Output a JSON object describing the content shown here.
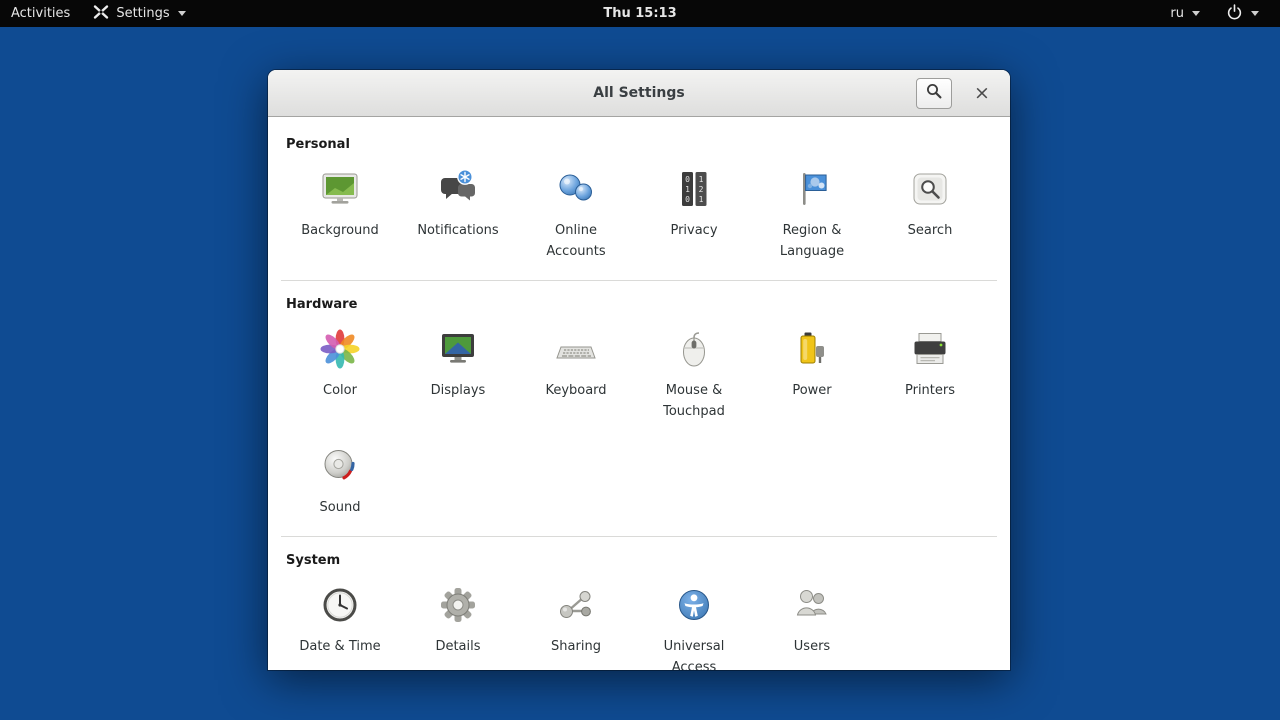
{
  "topbar": {
    "activities_label": "Activities",
    "app_menu_label": "Settings",
    "app_menu_icon": "crossed-tools-icon",
    "clock": "Thu 15:13",
    "keyboard_layout": "ru",
    "power_icon": "power-icon"
  },
  "window": {
    "title": "All Settings",
    "search_icon": "search-icon",
    "close_glyph": "×"
  },
  "sections": [
    {
      "title": "Personal",
      "items": [
        {
          "label": "Background",
          "icon": "background-icon"
        },
        {
          "label": "Notifications",
          "icon": "notifications-icon"
        },
        {
          "label": "Online\nAccounts",
          "icon": "online-accounts-icon"
        },
        {
          "label": "Privacy",
          "icon": "privacy-icon"
        },
        {
          "label": "Region &\nLanguage",
          "icon": "region-language-icon"
        },
        {
          "label": "Search",
          "icon": "search-tile-icon"
        }
      ]
    },
    {
      "title": "Hardware",
      "items": [
        {
          "label": "Color",
          "icon": "color-icon"
        },
        {
          "label": "Displays",
          "icon": "displays-icon"
        },
        {
          "label": "Keyboard",
          "icon": "keyboard-icon"
        },
        {
          "label": "Mouse &\nTouchpad",
          "icon": "mouse-icon"
        },
        {
          "label": "Power",
          "icon": "battery-icon"
        },
        {
          "label": "Printers",
          "icon": "printer-icon"
        },
        {
          "label": "Sound",
          "icon": "speaker-icon"
        }
      ]
    },
    {
      "title": "System",
      "items": [
        {
          "label": "Date & Time",
          "icon": "clock-icon"
        },
        {
          "label": "Details",
          "icon": "gear-icon"
        },
        {
          "label": "Sharing",
          "icon": "sharing-icon"
        },
        {
          "label": "Universal\nAccess",
          "icon": "universal-access-icon"
        },
        {
          "label": "Users",
          "icon": "users-icon"
        }
      ]
    }
  ],
  "colors": {
    "desktop": "#0f4b92",
    "topbar": "#070707",
    "accent_blue": "#4a90d9",
    "window_bg": "#ffffff"
  }
}
